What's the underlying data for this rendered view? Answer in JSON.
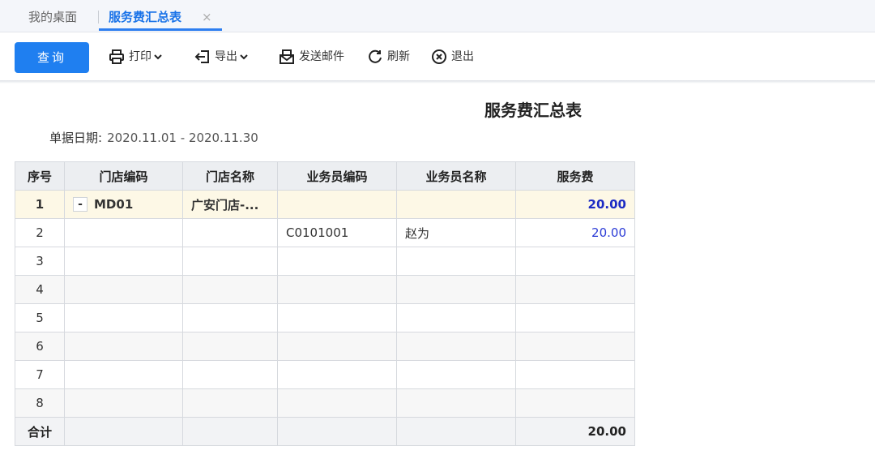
{
  "tabs": {
    "desk": "我的桌面",
    "active": "服务费汇总表",
    "close": "×"
  },
  "toolbar": {
    "query": "查询",
    "print": "打印",
    "export": "导出",
    "send_mail": "发送邮件",
    "refresh": "刷新",
    "exit": "退出"
  },
  "report": {
    "title": "服务费汇总表",
    "date_label": "单据日期:",
    "date_value": "2020.11.01 - 2020.11.30"
  },
  "table": {
    "headers": [
      "序号",
      "门店编码",
      "门店名称",
      "业务员编码",
      "业务员名称",
      "服务费"
    ],
    "rows": [
      {
        "seq": "1",
        "toggle": "-",
        "store_code": "MD01",
        "store_name": "广安门店-...",
        "staff_code": "",
        "staff_name": "",
        "fee": "20.00"
      },
      {
        "seq": "2",
        "toggle": "",
        "store_code": "",
        "store_name": "",
        "staff_code": "C0101001",
        "staff_name": "赵为",
        "fee": "20.00"
      },
      {
        "seq": "3",
        "toggle": "",
        "store_code": "",
        "store_name": "",
        "staff_code": "",
        "staff_name": "",
        "fee": ""
      },
      {
        "seq": "4",
        "toggle": "",
        "store_code": "",
        "store_name": "",
        "staff_code": "",
        "staff_name": "",
        "fee": ""
      },
      {
        "seq": "5",
        "toggle": "",
        "store_code": "",
        "store_name": "",
        "staff_code": "",
        "staff_name": "",
        "fee": ""
      },
      {
        "seq": "6",
        "toggle": "",
        "store_code": "",
        "store_name": "",
        "staff_code": "",
        "staff_name": "",
        "fee": ""
      },
      {
        "seq": "7",
        "toggle": "",
        "store_code": "",
        "store_name": "",
        "staff_code": "",
        "staff_name": "",
        "fee": ""
      },
      {
        "seq": "8",
        "toggle": "",
        "store_code": "",
        "store_name": "",
        "staff_code": "",
        "staff_name": "",
        "fee": ""
      }
    ],
    "total": {
      "label": "合计",
      "fee": "20.00"
    }
  },
  "colors": {
    "accent": "#1f7ff0",
    "fee_text": "#2b3bd6",
    "group_row_bg": "#fdf8e6"
  },
  "icons": [
    "printer-icon",
    "export-icon",
    "mail-icon",
    "refresh-icon",
    "exit-icon",
    "chevron-down-icon",
    "close-icon"
  ]
}
